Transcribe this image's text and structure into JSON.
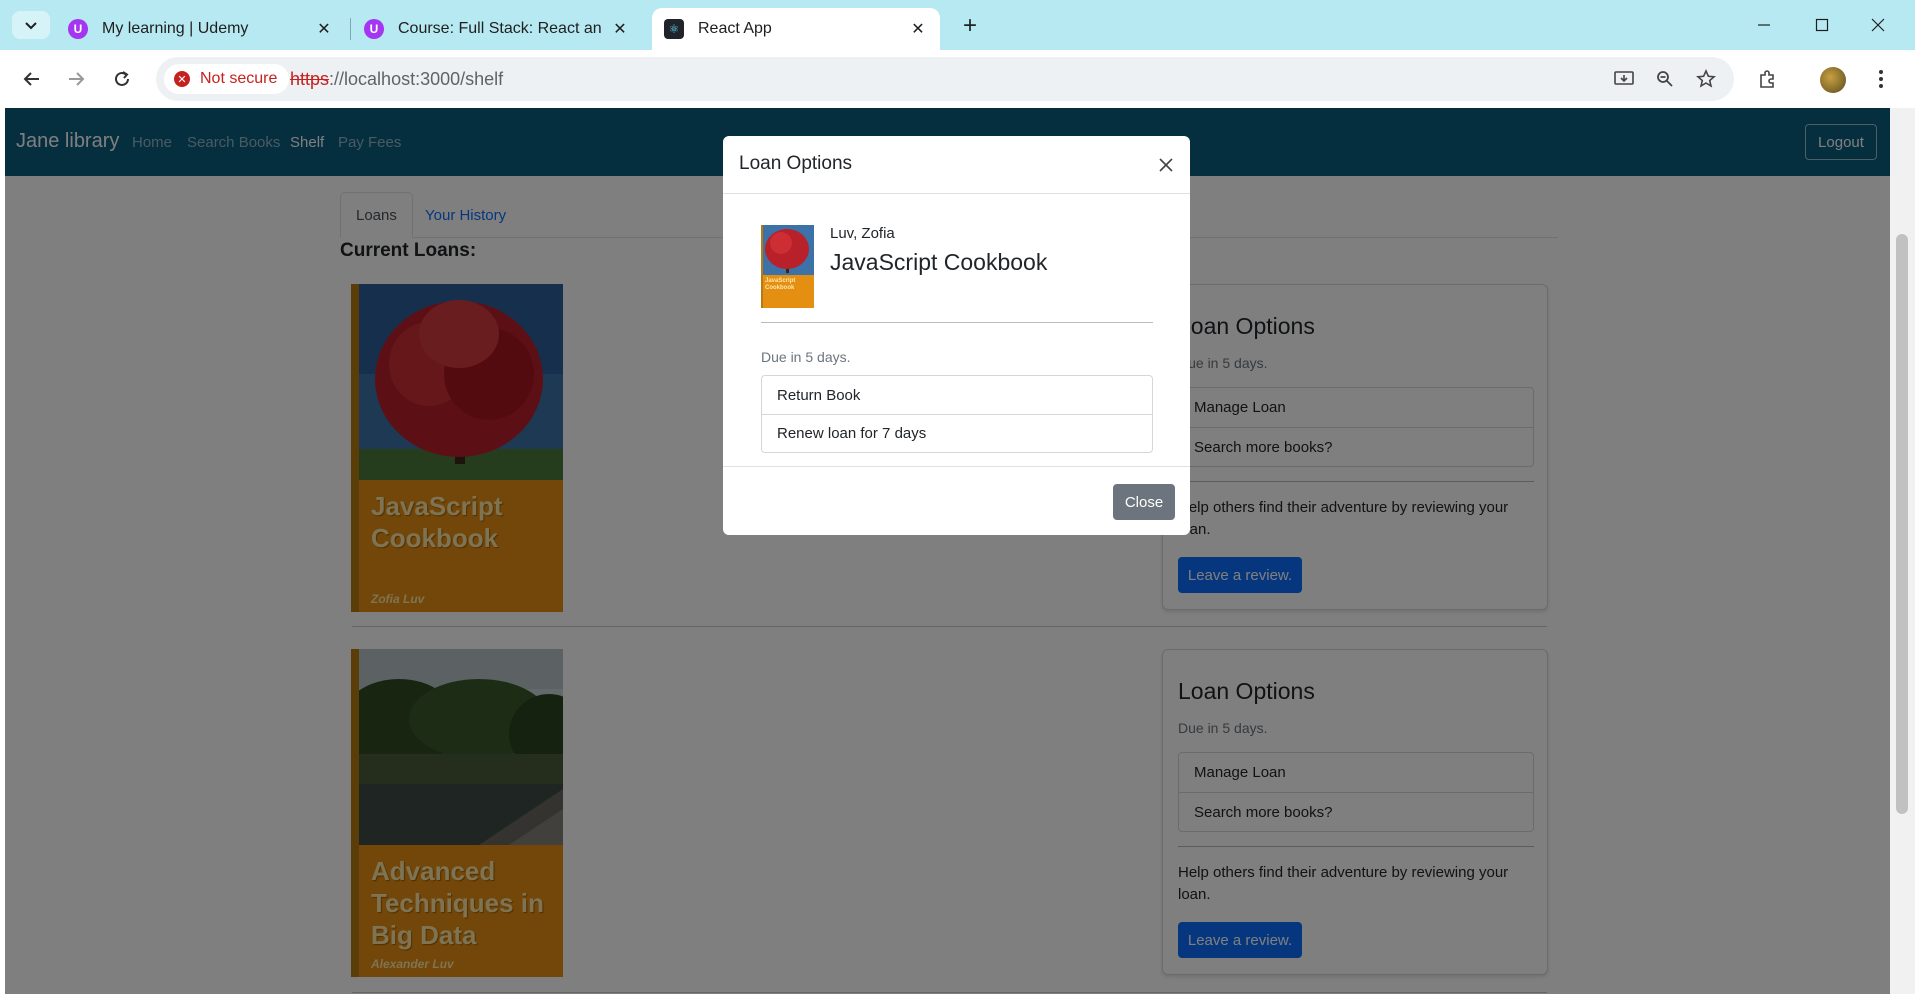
{
  "browser": {
    "tabs": [
      {
        "title": "My learning | Udemy",
        "favicon": "udemy-icon"
      },
      {
        "title": "Course: Full Stack: React and Java",
        "favicon": "udemy-icon"
      },
      {
        "title": "React App",
        "favicon": "react-icon",
        "active": true
      }
    ],
    "security_label": "Not secure",
    "url_protocol": "https",
    "url_rest": "://localhost:3000/shelf"
  },
  "app": {
    "brand": "Jane library",
    "nav": [
      "Home",
      "Search Books",
      "Shelf",
      "Pay Fees"
    ],
    "active_nav": "Shelf",
    "logout_label": "Logout"
  },
  "shelf": {
    "tabs": [
      "Loans",
      "Your History"
    ],
    "current_loans_title": "Current Loans:",
    "loans": [
      {
        "cover_title": "JavaScript Cookbook",
        "cover_author": "Zofia Luv",
        "options_title": "Loan Options",
        "due": "Due in 5 days.",
        "actions": [
          "Manage Loan",
          "Search more books?"
        ],
        "help": "Help others find their adventure by reviewing your loan.",
        "review_label": "Leave a review."
      },
      {
        "cover_title": "Advanced Techniques in Big Data",
        "cover_author": "Alexander Luv",
        "options_title": "Loan Options",
        "due": "Due in 5 days.",
        "actions": [
          "Manage Loan",
          "Search more books?"
        ],
        "help": "Help others find their adventure by reviewing your loan.",
        "review_label": "Leave a review."
      }
    ]
  },
  "modal": {
    "title": "Loan Options",
    "author": "Luv, Zofia",
    "book_title": "JavaScript Cookbook",
    "due": "Due in 5 days.",
    "actions": [
      "Return Book",
      "Renew loan for 7 days"
    ],
    "close_label": "Close"
  },
  "colors": {
    "tabstrip": "#b7e9f2",
    "app_nav": "#0a5d7e",
    "primary": "#0d6efd",
    "secondary": "#6c757d",
    "cover_band": "#e48f12"
  }
}
